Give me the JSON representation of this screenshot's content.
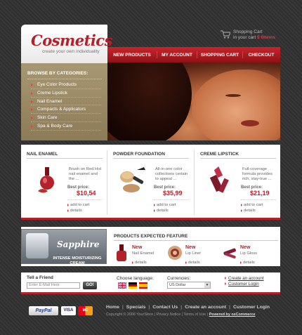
{
  "brand": {
    "name": "Cosmetics",
    "tagline": "create your own individuality"
  },
  "cart": {
    "line1": "Shopping Cart",
    "line2_prefix": "in your cart",
    "amount": "$ 0items",
    "icon": "cart-icon"
  },
  "nav": [
    "NEW PRODUCTS",
    "MY ACCOUNT",
    "SHOPPING CART",
    "CHECKOUT"
  ],
  "sidebar": {
    "heading": "BROWSE BY CATEGORIES:",
    "items": [
      {
        "label": "Eye Color Products"
      },
      {
        "label": "Creme Lipstick"
      },
      {
        "label": "Nail Enamel"
      },
      {
        "label": "Compacts & Applicators"
      },
      {
        "label": "Skin Care"
      },
      {
        "label": "Spa & Body Care"
      }
    ]
  },
  "products": [
    {
      "title": "NAIL ENAMEL",
      "desc": "Brush on Red Hot nail enamel and the ...",
      "best_price_label": "Best price:",
      "price": "$10,54",
      "add": "add to cart",
      "details": "details"
    },
    {
      "title": "POWDER FOUNDATION",
      "desc": "All-in-one color collections certain to appeal ...",
      "best_price_label": "Best price:",
      "price": "$35,99",
      "add": "add to cart",
      "details": "details"
    },
    {
      "title": "CREME LIPSTICK",
      "desc": "Full-coverage formula provides rich, stay-true ...",
      "best_price_label": "Best price:",
      "price": "$21,19",
      "add": "add to cart",
      "details": "details"
    }
  ],
  "promo": {
    "name": "Sapphire",
    "subtitle": "INTENSE MOISTURIZING CREAM"
  },
  "expected": {
    "heading": "PRODUCTS EXPECTED FEATURE",
    "items": [
      {
        "new": "New",
        "name": "Nail Enamel",
        "details": "details"
      },
      {
        "new": "New",
        "name": "Lip Liner",
        "details": "details"
      },
      {
        "new": "New",
        "name": "Lip Gloss",
        "details": "details"
      }
    ]
  },
  "tell": {
    "label": "Tell a Friend",
    "placeholder": "Enter E-Mail Here",
    "button": "GO!"
  },
  "language": {
    "label": "Choose language:"
  },
  "currency": {
    "label": "Currencies:",
    "selected": "US Dollar"
  },
  "account_links": [
    "Create an account",
    "Customer Login"
  ],
  "payments": [
    "PayPal",
    "VISA",
    "MC"
  ],
  "footer": {
    "links": [
      "Home",
      "Specials",
      "Contact Us",
      "Create an account",
      "Customer Login"
    ],
    "copyright": "Copyright © 2006 YourStore",
    "privacy": "Privacy Notice",
    "terms": "Terms of Use",
    "powered": "Powered by osCommerce"
  }
}
